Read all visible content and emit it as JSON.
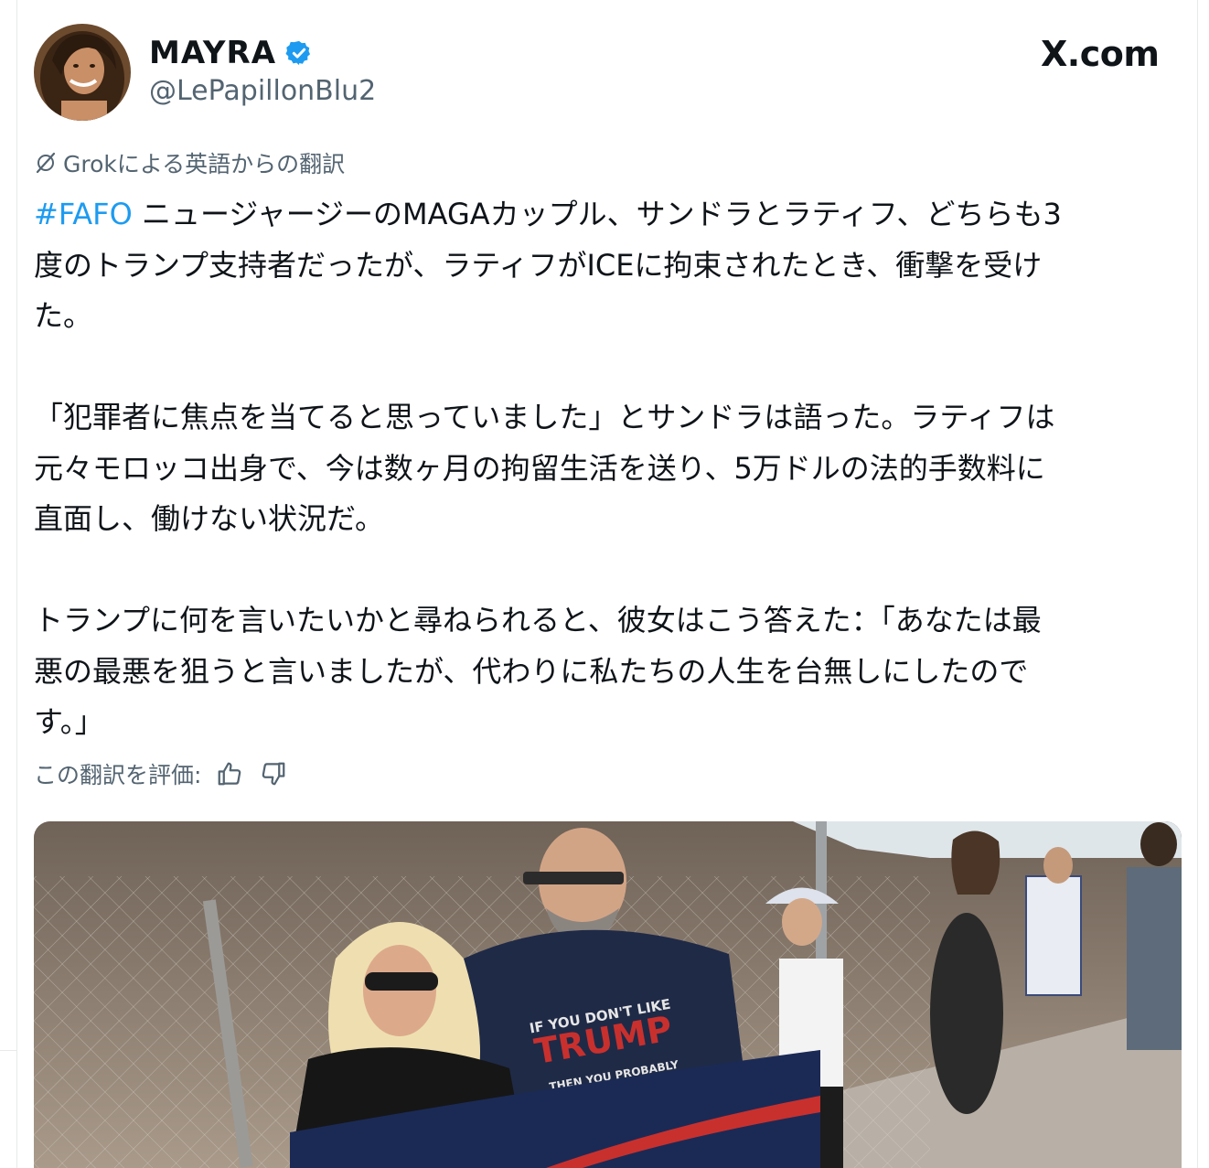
{
  "tweet": {
    "author": {
      "display_name": "MAYRA",
      "handle": "@LePapillonBlu2",
      "verified": true
    },
    "source_logo": "X.com",
    "translation_note": "Grokによる英語からの翻訳",
    "body": {
      "hashtag": "#FAFO",
      "para1_rest": " ニュージャージーのMAGAカップル、サンドラとラティフ、どちらも3\n度のトランプ支持者だったが、ラティフがICEに拘束されたとき、衝撃を受け\nた。",
      "para2": "「犯罪者に焦点を当てると思っていました」とサンドラは語った。ラティフは\n元々モロッコ出身で、今は数ヶ月の拘留生活を送り、5万ドルの法的手数料に\n直面し、働けない状況だ。",
      "para3": "トランプに何を言いたいかと尋ねられると、彼女はこう答えた：「あなたは最\n悪の最悪を狙うと言いましたが、代わりに私たちの人生を台無しにしたので\nす。」"
    },
    "rating": {
      "label": "この翻訳を評価:"
    },
    "media": {
      "shirt_line1": "IF YOU DON'T LIKE",
      "shirt_line2": "TRUMP",
      "shirt_line3": "THEN YOU PROBABLY"
    },
    "colors": {
      "accent": "#1d9bf0",
      "secondary_text": "#536471",
      "primary_text": "#0f1419"
    }
  }
}
